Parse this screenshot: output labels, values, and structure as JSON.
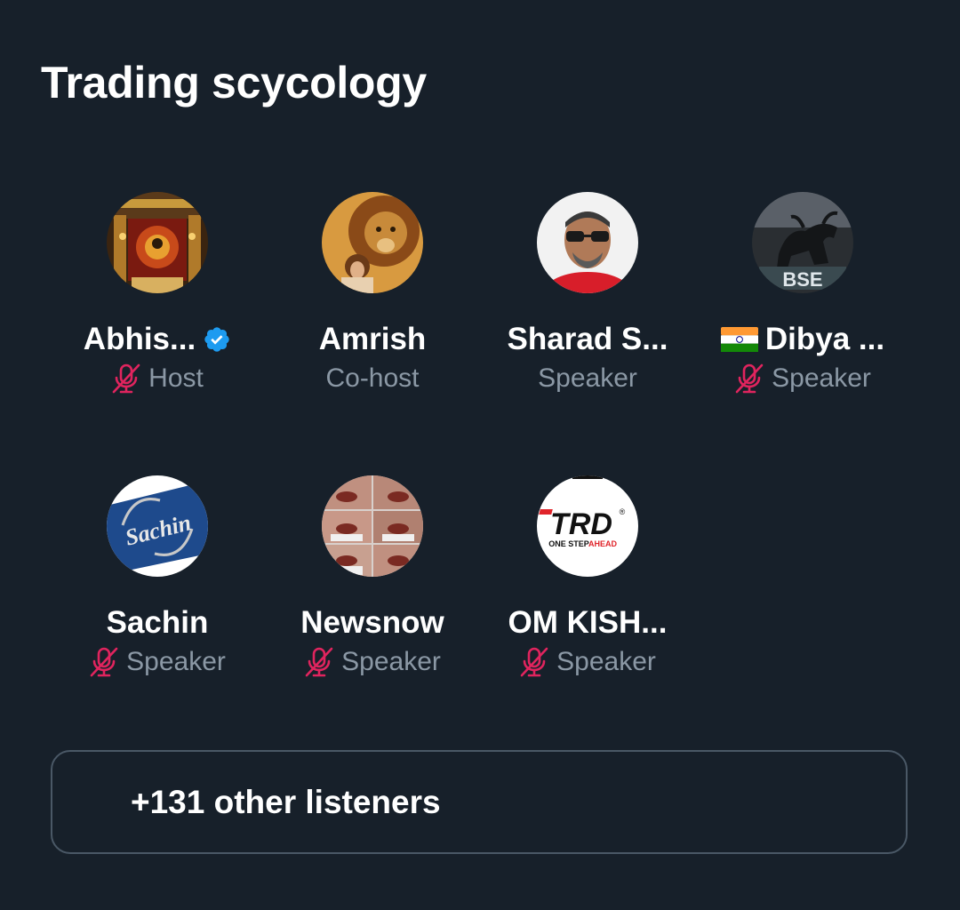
{
  "space": {
    "title": "Trading scycology"
  },
  "speakers": [
    {
      "name": "Abhis...",
      "role": "Host",
      "muted": true,
      "verified": true,
      "flag": false,
      "avatar_icon": "temple-shrine-avatar"
    },
    {
      "name": "Amrish",
      "role": "Co-host",
      "muted": false,
      "verified": false,
      "flag": false,
      "avatar_icon": "lion-avatar"
    },
    {
      "name": "Sharad S...",
      "role": "Speaker",
      "muted": false,
      "verified": false,
      "flag": false,
      "avatar_icon": "man-sunglasses-avatar"
    },
    {
      "name": "Dibya ...",
      "role": "Speaker",
      "muted": true,
      "verified": false,
      "flag": true,
      "avatar_icon": "bse-bull-avatar"
    },
    {
      "name": "Sachin",
      "role": "Speaker",
      "muted": true,
      "verified": false,
      "flag": false,
      "avatar_icon": "sachin-logo-avatar"
    },
    {
      "name": "Newsnow",
      "role": "Speaker",
      "muted": true,
      "verified": false,
      "flag": false,
      "avatar_icon": "collage-faces-avatar"
    },
    {
      "name": "OM KISH...",
      "role": "Speaker",
      "muted": true,
      "verified": false,
      "flag": false,
      "avatar_icon": "trd-logo-avatar"
    }
  ],
  "avatar_texts": {
    "bse": "BSE",
    "sachin": "Sachin",
    "trd": "TRD",
    "trd_tagline_a": "ONE STEP",
    "trd_tagline_b": "AHEAD",
    "trd_reg": "®"
  },
  "listeners": {
    "label": "+131 other listeners"
  },
  "colors": {
    "background": "#17202a",
    "muted_mic": "#e0245e",
    "secondary_text": "#8b98a5",
    "verified_badge": "#1d9bf0",
    "border": "#4a5866"
  }
}
